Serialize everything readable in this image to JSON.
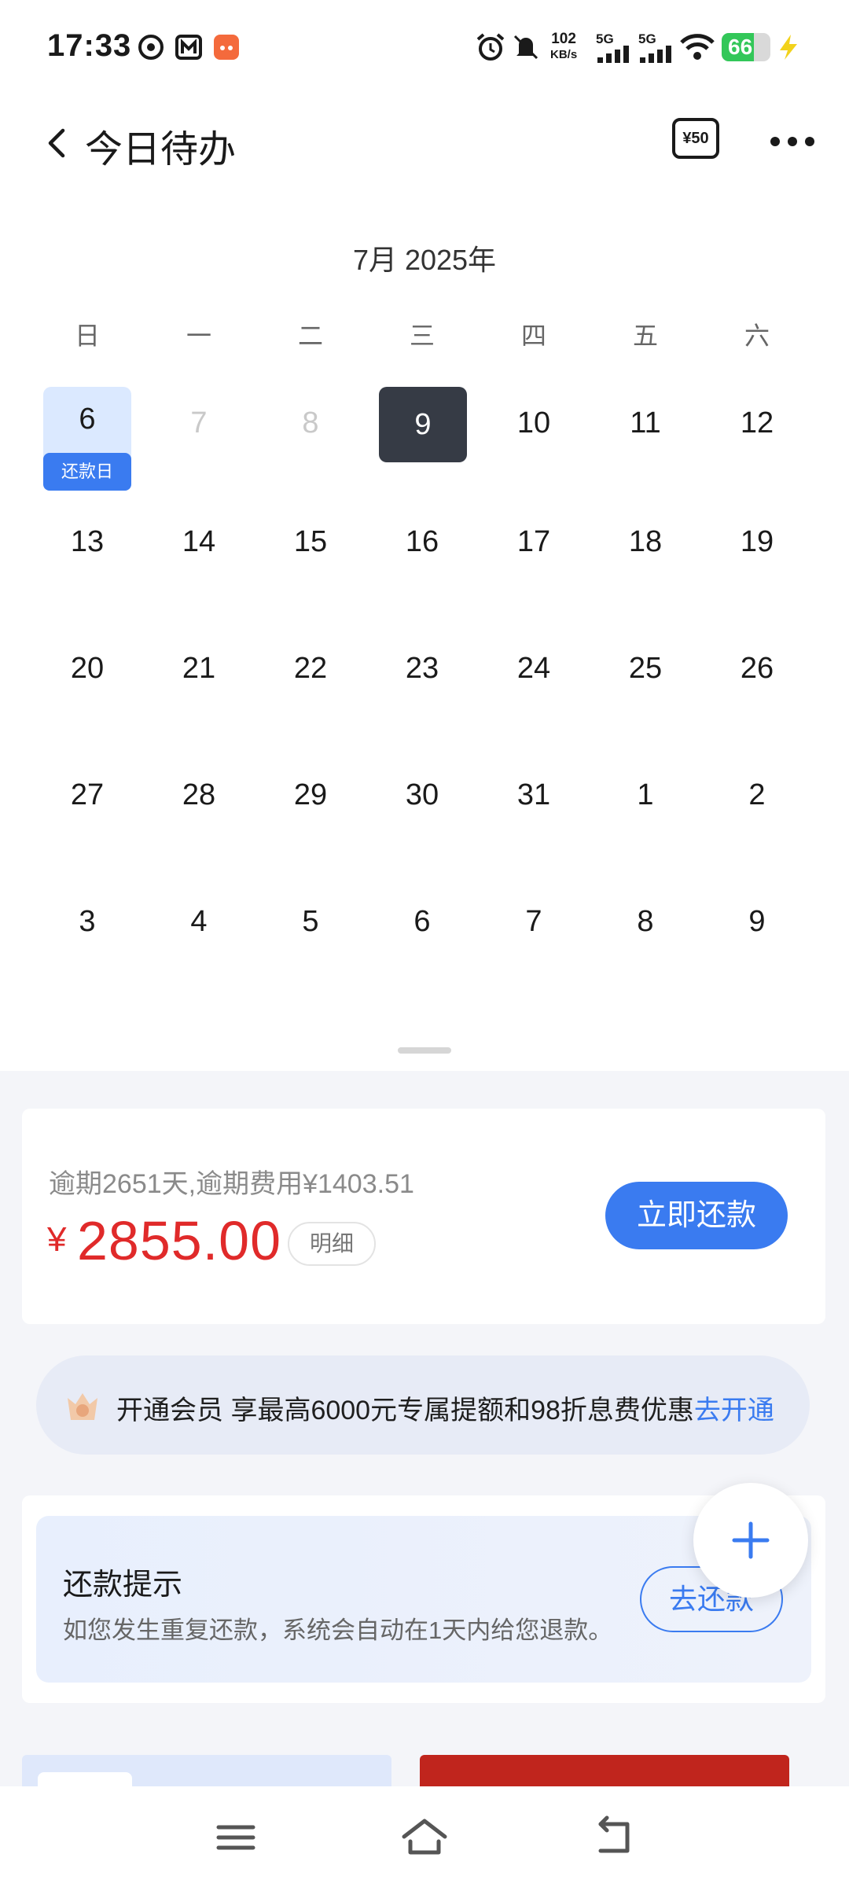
{
  "status_bar": {
    "time": "17:33",
    "network_speed_value": "102",
    "network_speed_unit": "KB/s",
    "signal1": "5G",
    "signal2": "5G",
    "battery": "66",
    "battery_level": 0.66
  },
  "header": {
    "title": "今日待办",
    "coupon_label": "¥50"
  },
  "calendar": {
    "month_label": "7月 2025年",
    "weekdays": [
      "日",
      "一",
      "二",
      "三",
      "四",
      "五",
      "六"
    ],
    "weeks": [
      [
        "6",
        "7",
        "8",
        "9",
        "10",
        "11",
        "12"
      ],
      [
        "13",
        "14",
        "15",
        "16",
        "17",
        "18",
        "19"
      ],
      [
        "20",
        "21",
        "22",
        "23",
        "24",
        "25",
        "26"
      ],
      [
        "27",
        "28",
        "29",
        "30",
        "31",
        "1",
        "2"
      ],
      [
        "3",
        "4",
        "5",
        "6",
        "7",
        "8",
        "9"
      ]
    ],
    "due_day": "6",
    "due_tag": "还款日",
    "today": "9"
  },
  "overdue": {
    "note": "逾期2651天,逾期费用¥1403.51",
    "currency": "¥",
    "amount": "2855.00",
    "detail_label": "明细",
    "pay_label": "立即还款"
  },
  "vip": {
    "text": "开通会员 享最高6000元专属提额和98折息费优惠",
    "link": "去开通"
  },
  "reminder": {
    "title": "还款提示",
    "desc": "如您发生重复还款，系统会自动在1天内给您退款。",
    "button": "去还款"
  },
  "colors": {
    "accent": "#3a7bf0",
    "amount": "#e02a2a",
    "today_bg": "#363b45",
    "due_bg": "#dbe9ff"
  },
  "icons": {
    "back": "chevron-left-icon",
    "more": "more-dots-icon",
    "fab": "plus-icon",
    "nav": [
      "menu-icon",
      "home-icon",
      "back-icon"
    ]
  }
}
